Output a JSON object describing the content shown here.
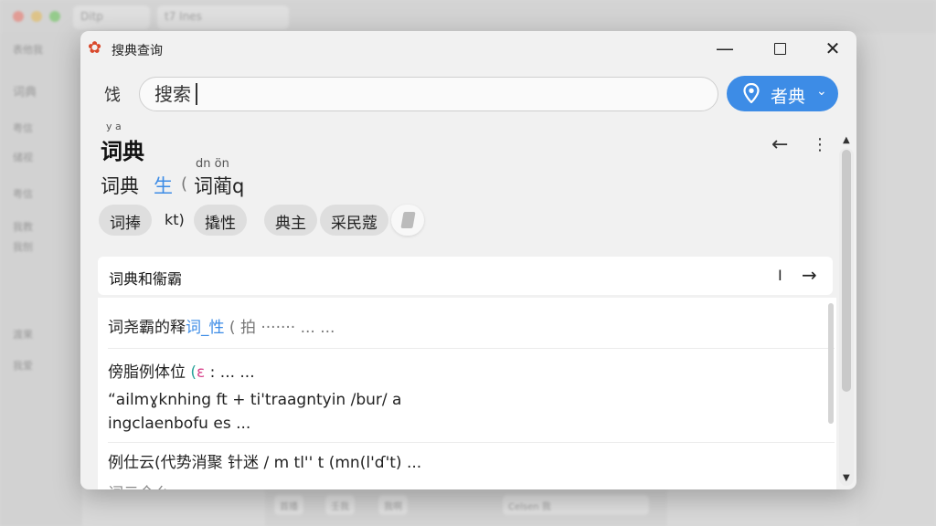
{
  "background": {
    "tabs": [
      "Ditp",
      "t7 Ines"
    ],
    "sidebar_items": [
      "表他我",
      "词典",
      "粤信",
      "储视",
      "粤信",
      "我教",
      "我刨",
      "渡果",
      "我爱"
    ],
    "bottom_buttons": [
      "首播",
      "壬我",
      "我啊",
      "Celsen 我"
    ]
  },
  "window": {
    "app_name": "搜典查询",
    "controls": {
      "minimize": "—",
      "close": "✕"
    }
  },
  "search": {
    "lang_label": "饯",
    "placeholder": "搜索",
    "dict_button_label": "者典",
    "dict_button_chevron": "⌄"
  },
  "entry": {
    "pinyin_top": "y a",
    "headword": "词典",
    "pinyin_sub": "dn ön",
    "sub_part_a": "词典",
    "sub_part_b": "生",
    "sub_part_c": "(",
    "sub_part_d": "词蔺q",
    "chips": [
      "词捧",
      "kt)",
      "撬性",
      "典主",
      "采民蔻"
    ],
    "tools": {
      "back": "←",
      "more": "⋮",
      "scroll_up": "▲",
      "scroll_down": "▼"
    }
  },
  "definitions": {
    "card_title": "词典和衞霸",
    "card_sep": "I",
    "card_arrow": "→",
    "line1_a": "词尧霸的释",
    "line1_b": "词_性",
    "line1_c": "(  拍",
    "line1_d": "·······  ...     ...",
    "line2_a": "傍脂例体位",
    "line2_b": "(",
    "line2_c": "ε",
    "line2_d": "  : ...  ...",
    "line3": "“ailmɣknhing ft + ti'traagntyin /bur/ a",
    "line4": "ingclaenbofu es     ...",
    "line5": "例仕云(代势消聚 针迷 / m tl'' t (mn(l'ɗ't) ...",
    "line6": "词云全么... ... ..."
  }
}
